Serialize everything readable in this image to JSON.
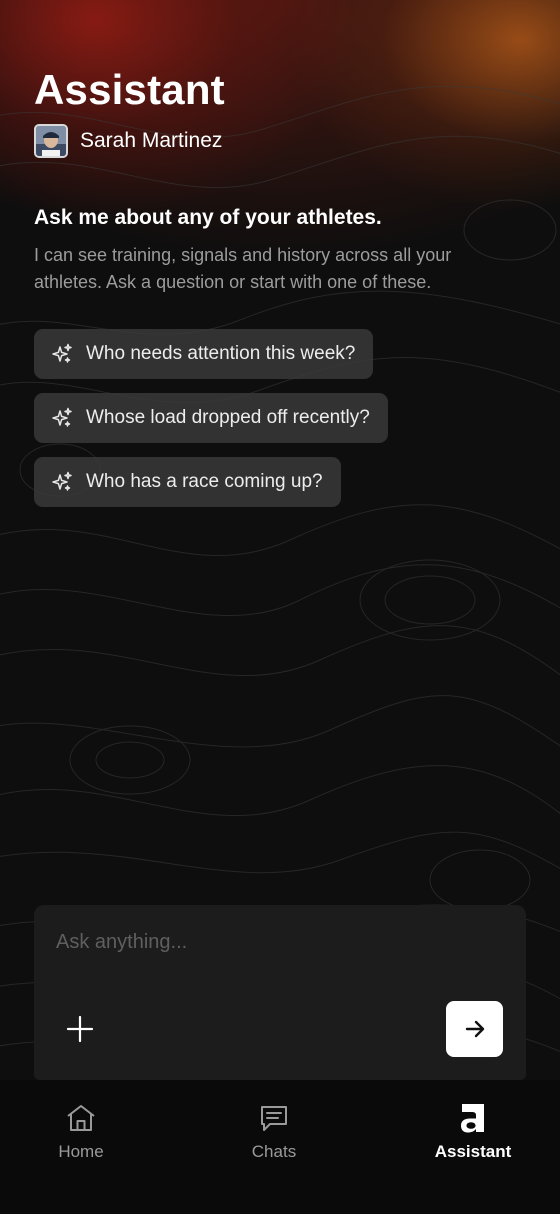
{
  "header": {
    "title": "Assistant",
    "athlete_name": "Sarah Martinez"
  },
  "intro": {
    "title": "Ask me about any of your athletes.",
    "body": "I can see training, signals and history across all your athletes. Ask a question or start with one of these."
  },
  "suggestions": [
    {
      "label": "Who needs attention this week?",
      "icon": "sparkle-icon"
    },
    {
      "label": "Whose load dropped off recently?",
      "icon": "sparkle-icon"
    },
    {
      "label": "Who has a race coming up?",
      "icon": "sparkle-icon"
    }
  ],
  "composer": {
    "placeholder": "Ask anything...",
    "value": "",
    "add_icon": "plus-icon",
    "send_icon": "arrow-right-icon"
  },
  "tabs": [
    {
      "label": "Home",
      "icon": "home-icon",
      "active": false
    },
    {
      "label": "Chats",
      "icon": "chat-icon",
      "active": false
    },
    {
      "label": "Assistant",
      "icon": "assistant-logo-icon",
      "active": true
    }
  ],
  "colors": {
    "background": "#0e0e0e",
    "glow_red": "#961c14",
    "glow_orange": "#be5f19",
    "chip_bg": "#3a3a3a",
    "composer_bg": "#1c1c1c",
    "tabbar_bg": "#0a0a0a",
    "muted_text": "#9c9c9c"
  }
}
